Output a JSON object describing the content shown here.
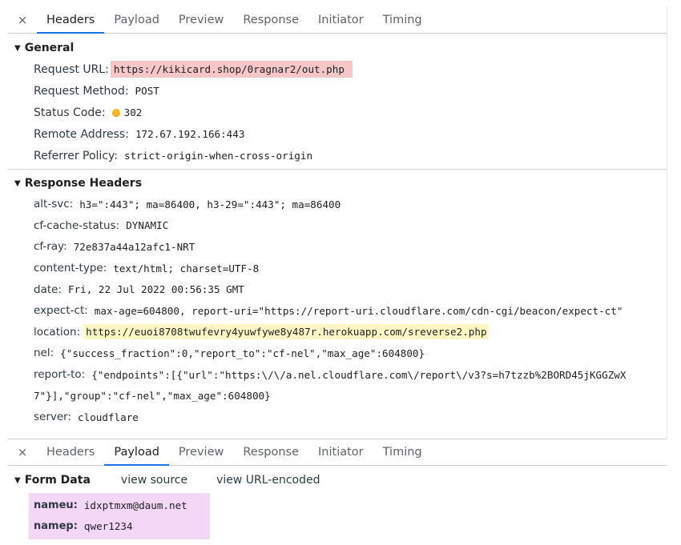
{
  "tabs": {
    "close": "×",
    "items": [
      "Headers",
      "Payload",
      "Preview",
      "Response",
      "Initiator",
      "Timing"
    ]
  },
  "general": {
    "title": "General",
    "rows": [
      {
        "key": "Request URL:",
        "value": "https://kikicard.shop/0ragnar2/out.php"
      },
      {
        "key": "Request Method:",
        "value": "POST"
      },
      {
        "key": "Status Code:",
        "value": "302"
      },
      {
        "key": "Remote Address:",
        "value": "172.67.192.166:443"
      },
      {
        "key": "Referrer Policy:",
        "value": "strict-origin-when-cross-origin"
      }
    ]
  },
  "response_headers": {
    "title": "Response Headers",
    "rows": [
      {
        "key": "alt-svc:",
        "value": "h3=\":443\"; ma=86400, h3-29=\":443\"; ma=86400"
      },
      {
        "key": "cf-cache-status:",
        "value": "DYNAMIC"
      },
      {
        "key": "cf-ray:",
        "value": "72e837a44a12afc1-NRT"
      },
      {
        "key": "content-type:",
        "value": "text/html; charset=UTF-8"
      },
      {
        "key": "date:",
        "value": "Fri, 22 Jul 2022 00:56:35 GMT"
      },
      {
        "key": "expect-ct:",
        "value": "max-age=604800, report-uri=\"https://report-uri.cloudflare.com/cdn-cgi/beacon/expect-ct\""
      },
      {
        "key": "location:",
        "value": "https://euoi8708twufevry4yuwfywe8y487r.herokuapp.com/sreverse2.php"
      },
      {
        "key": "nel:",
        "value": "{\"success_fraction\":0,\"report_to\":\"cf-nel\",\"max_age\":604800}"
      },
      {
        "key": "report-to:",
        "value": "{\"endpoints\":[{\"url\":\"https:\\/\\/a.nel.cloudflare.com\\/report\\/v3?s=h7tzzb%2BORD45jKGGZwX"
      },
      {
        "key": "",
        "value": "7\"}],\"group\":\"cf-nel\",\"max_age\":604800}"
      },
      {
        "key": "server:",
        "value": "cloudflare"
      }
    ]
  },
  "payload": {
    "form_data_title": "Form Data",
    "view_source": "view source",
    "view_url_encoded": "view URL-encoded",
    "rows": [
      {
        "key": "nameu:",
        "value": "idxptmxm@daum.net"
      },
      {
        "key": "namep:",
        "value": "qwer1234"
      }
    ]
  },
  "colors": {
    "accent": "#1a73e8",
    "url_highlight": "#f7c7c7",
    "location_highlight": "#fdf8c4",
    "form_highlight": "#f4d6f7",
    "status_dot": "#f3b81d"
  }
}
